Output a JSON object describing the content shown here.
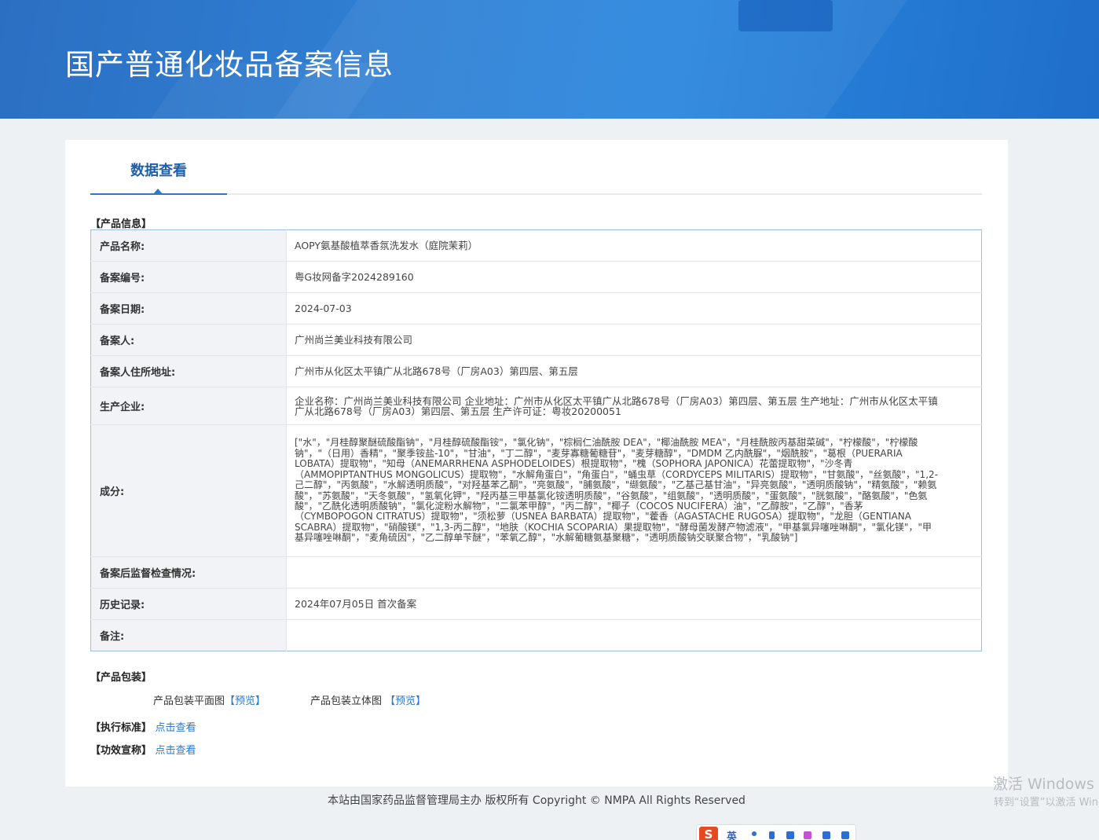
{
  "header": {
    "title": "国产普通化妆品备案信息"
  },
  "tabs": [
    {
      "label": "数据查看"
    }
  ],
  "product_info": {
    "section_label": "【产品信息】",
    "rows": [
      {
        "key": "产品名称:",
        "value": "AOPY氨基酸植萃香氛洗发水（庭院茉莉）"
      },
      {
        "key": "备案编号:",
        "value": "粤G妆网备字2024289160"
      },
      {
        "key": "备案日期:",
        "value": "2024-07-03"
      },
      {
        "key": "备案人:",
        "value": "广州尚兰美业科技有限公司"
      },
      {
        "key": "备案人住所地址:",
        "value": "广州市从化区太平镇广从北路678号（厂房A03）第四层、第五层"
      },
      {
        "key": "生产企业:",
        "value": "企业名称：广州尚兰美业科技有限公司 企业地址：广州市从化区太平镇广从北路678号（厂房A03）第四层、第五层 生产地址：广州市从化区太平镇广从北路678号（厂房A03）第四层、第五层 生产许可证：粤妆20200051"
      },
      {
        "key": "成分:",
        "value": "[\"水\"，\"月桂醇聚醚硫酸酯钠\"，\"月桂醇硫酸酯铵\"，\"氯化钠\"，\"棕榈仁油酰胺 DEA\"，\"椰油酰胺 MEA\"，\"月桂酰胺丙基甜菜碱\"，\"柠檬酸\"，\"柠檬酸钠\"，\"（日用）香精\"，\"聚季铵盐-10\"，\"甘油\"，\"丁二醇\"，\"麦芽寡糖葡糖苷\"，\"麦芽糖醇\"，\"DMDM 乙内酰脲\"，\"烟酰胺\"，\"葛根（PUERARIA LOBATA）提取物\"，\"知母（ANEMARRHENA ASPHODELOIDES）根提取物\"，\"槐（SOPHORA JAPONICA）花蕾提取物\"，\"沙冬青（AMMOPIPTANTHUS MONGOLICUS）提取物\"，\"水解角蛋白\"，\"角蛋白\"，\"蛹虫草（CORDYCEPS MILITARIS）提取物\"，\"甘氨酸\"，\"丝氨酸\"，\"1,2-己二醇\"，\"丙氨酸\"，\"水解透明质酸\"，\"对羟基苯乙酮\"，\"亮氨酸\"，\"脯氨酸\"，\"缬氨酸\"，\"乙基己基甘油\"，\"异亮氨酸\"，\"透明质酸钠\"，\"精氨酸\"，\"赖氨酸\"，\"苏氨酸\"，\"天冬氨酸\"，\"氢氧化钾\"，\"羟丙基三甲基氯化铵透明质酸\"，\"谷氨酸\"，\"组氨酸\"，\"透明质酸\"，\"蛋氨酸\"，\"胱氨酸\"，\"酪氨酸\"，\"色氨酸\"，\"乙酰化透明质酸钠\"，\"氯化淀粉水解物\"，\"二氯苯甲醇\"，\"丙二醇\"，\"椰子（COCOS NUCIFERA）油\"，\"乙醇胺\"，\"乙醇\"，\"香茅（CYMBOPOGON CITRATUS）提取物\"，\"须松萝（USNEA BARBATA）提取物\"，\"藿香（AGASTACHE RUGOSA）提取物\"，\"龙胆（GENTIANA SCABRA）提取物\"，\"硝酸镁\"，\"1,3-丙二醇\"，\"地肤（KOCHIA SCOPARIA）果提取物\"，\"酵母菌发酵产物滤液\"，\"甲基氯异噻唑啉酮\"，\"氯化镁\"，\"甲基异噻唑啉酮\"，\"麦角硫因\"，\"乙二醇单苄醚\"，\"苯氧乙醇\"，\"水解葡糖氨基聚糖\"，\"透明质酸钠交联聚合物\"，\"乳酸钠\"]"
      },
      {
        "key": "备案后监督检查情况:",
        "value": ""
      },
      {
        "key": "历史记录:",
        "value": "2024年07月05日 首次备案"
      },
      {
        "key": "备注:",
        "value": ""
      }
    ]
  },
  "packaging": {
    "section_label": "【产品包装】",
    "flat_label": "产品包装平面图",
    "flat_link": "【预览】",
    "solid_label": "产品包装立体图",
    "solid_link": "【预览】"
  },
  "standards": {
    "label": "【执行标准】",
    "link": "点击查看"
  },
  "efficacy": {
    "label": "【功效宣称】",
    "link": "点击查看"
  },
  "footer": {
    "text": "本站由国家药品监督管理局主办 版权所有 Copyright © NMPA All Rights Reserved"
  },
  "watermark": {
    "line1": "激活 Windows",
    "line2": "转到“设置”以激活 Windows。"
  },
  "ime": {
    "logo": "S",
    "mode": "英"
  }
}
